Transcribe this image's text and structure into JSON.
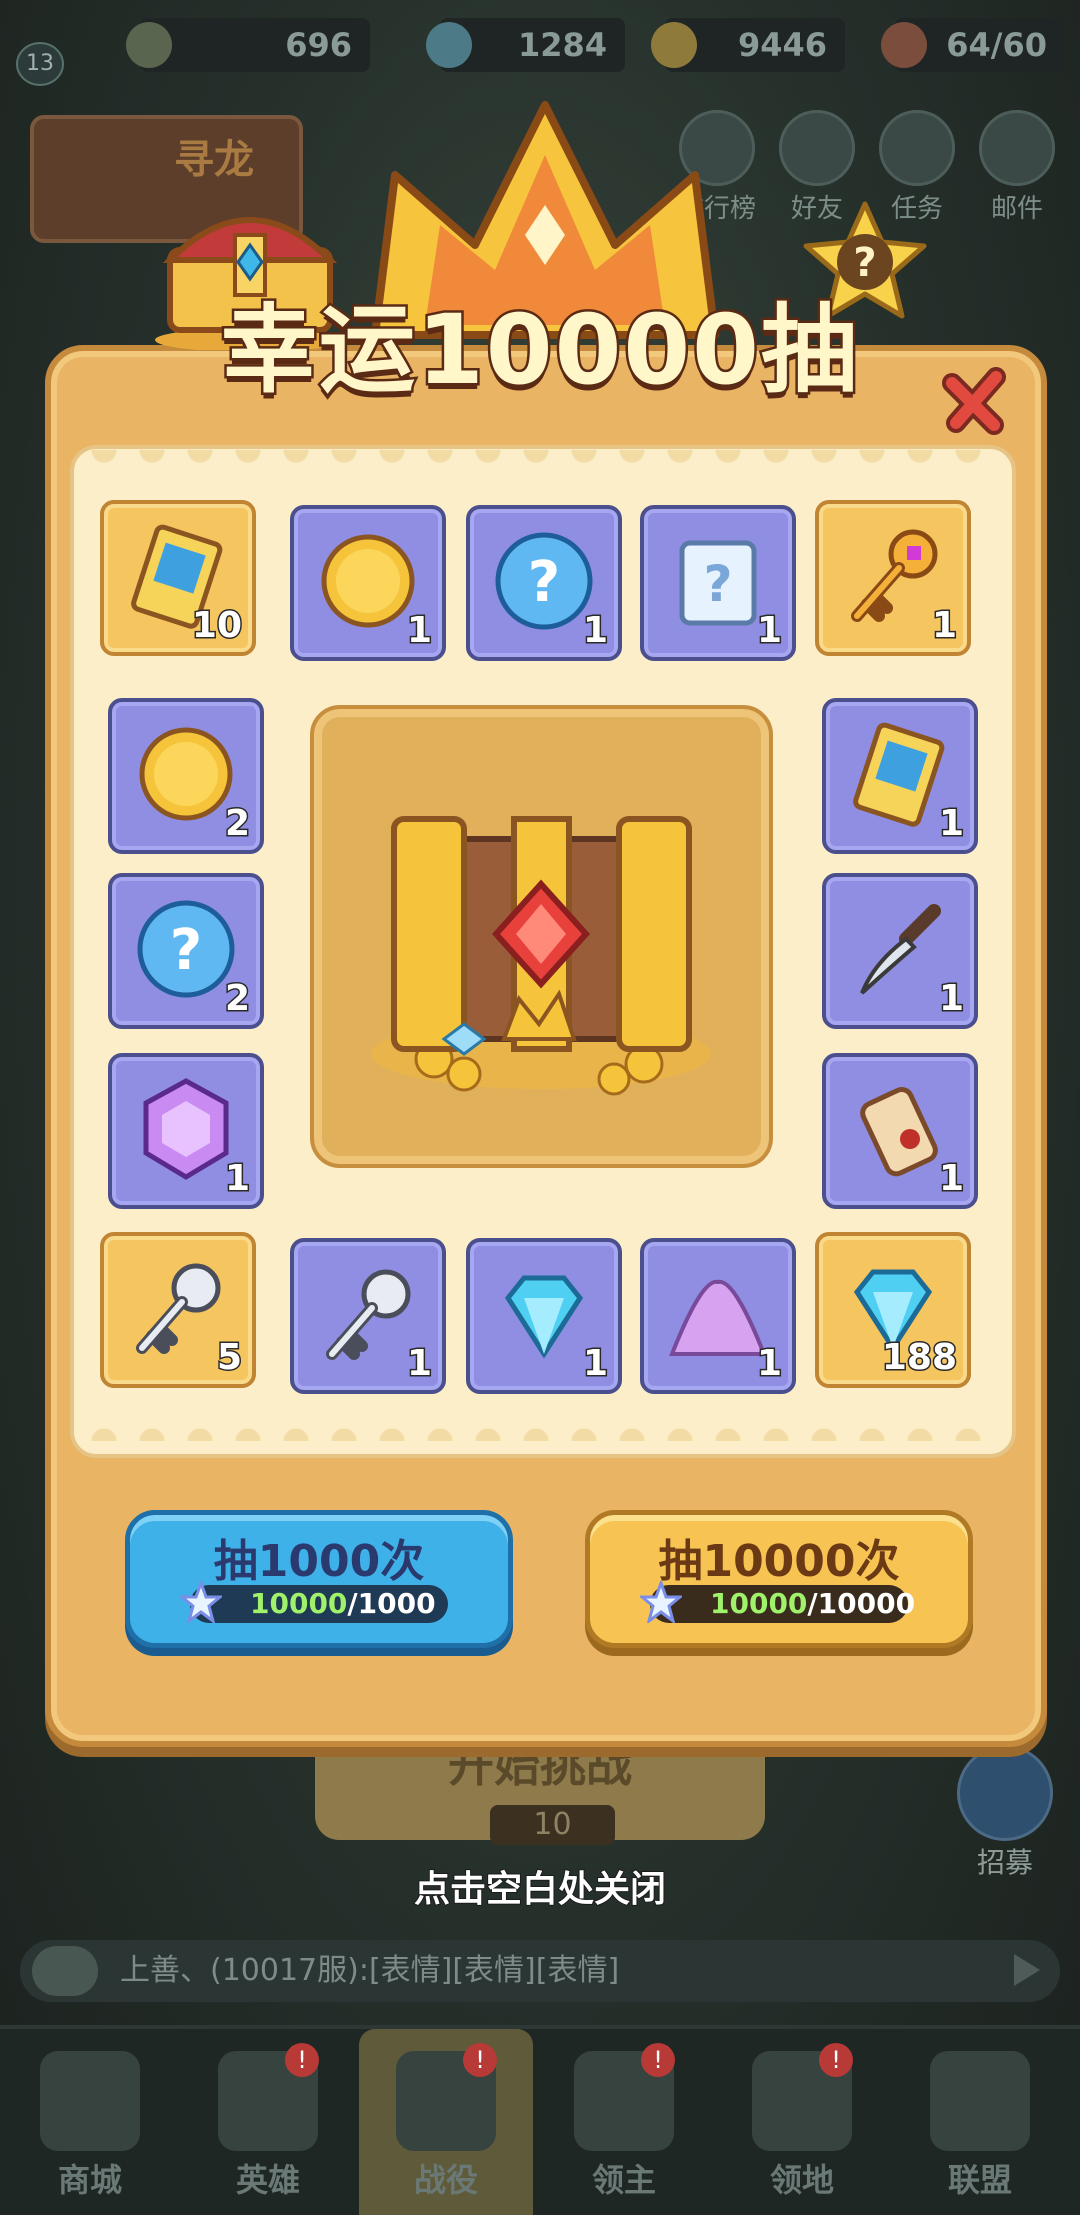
{
  "hud": {
    "level": "13",
    "power": "696",
    "diamonds": "1284",
    "gold": "9446",
    "stamina": "64/60"
  },
  "top_menu": [
    {
      "label": "排行榜",
      "icon": "leaderboard-icon"
    },
    {
      "label": "好友",
      "icon": "friends-icon"
    },
    {
      "label": "任务",
      "icon": "quest-icon"
    },
    {
      "label": "邮件",
      "icon": "mail-icon"
    }
  ],
  "side_banner": "寻龙",
  "dialog": {
    "title": "幸运10000抽",
    "rewards": [
      {
        "name": "ticket",
        "qty": "10",
        "frame": "gold"
      },
      {
        "name": "gold-coin",
        "qty": "1",
        "frame": "blue"
      },
      {
        "name": "mystery-orb",
        "qty": "1",
        "frame": "blue"
      },
      {
        "name": "mystery-scroll",
        "qty": "1",
        "frame": "blue"
      },
      {
        "name": "gold-key",
        "qty": "1",
        "frame": "gold"
      },
      {
        "name": "gold-coin",
        "qty": "2",
        "frame": "blue"
      },
      {
        "name": "ticket",
        "qty": "1",
        "frame": "blue"
      },
      {
        "name": "mystery-orb",
        "qty": "2",
        "frame": "blue"
      },
      {
        "name": "dagger",
        "qty": "1",
        "frame": "blue"
      },
      {
        "name": "purple-gem",
        "qty": "1",
        "frame": "blue"
      },
      {
        "name": "scroll",
        "qty": "1",
        "frame": "blue"
      },
      {
        "name": "silver-key",
        "qty": "5",
        "frame": "gold"
      },
      {
        "name": "silver-key",
        "qty": "1",
        "frame": "blue"
      },
      {
        "name": "diamond",
        "qty": "1",
        "frame": "blue"
      },
      {
        "name": "purple-dust",
        "qty": "1",
        "frame": "blue"
      },
      {
        "name": "diamond",
        "qty": "188",
        "frame": "gold"
      }
    ],
    "buttons": [
      {
        "label": "抽1000次",
        "have": "10000",
        "need": "/1000"
      },
      {
        "label": "抽10000次",
        "have": "10000",
        "need": "/10000"
      }
    ]
  },
  "background": {
    "start_label": "开始挑战",
    "start_cost": "10",
    "recruit": "招募",
    "close_hint": "点击空白处关闭",
    "chat": "上善、(10017服):[表情][表情][表情]"
  },
  "nav": [
    {
      "label": "商城",
      "badge": false
    },
    {
      "label": "英雄",
      "badge": true
    },
    {
      "label": "战役",
      "badge": true,
      "active": true
    },
    {
      "label": "领主",
      "badge": true
    },
    {
      "label": "领地",
      "badge": true
    },
    {
      "label": "联盟",
      "badge": false
    }
  ],
  "colors": {
    "accent_gold": "#f5c560",
    "accent_blue": "#8f8ee3",
    "button_blue": "#3fb1e9",
    "button_yellow": "#f7c453"
  }
}
